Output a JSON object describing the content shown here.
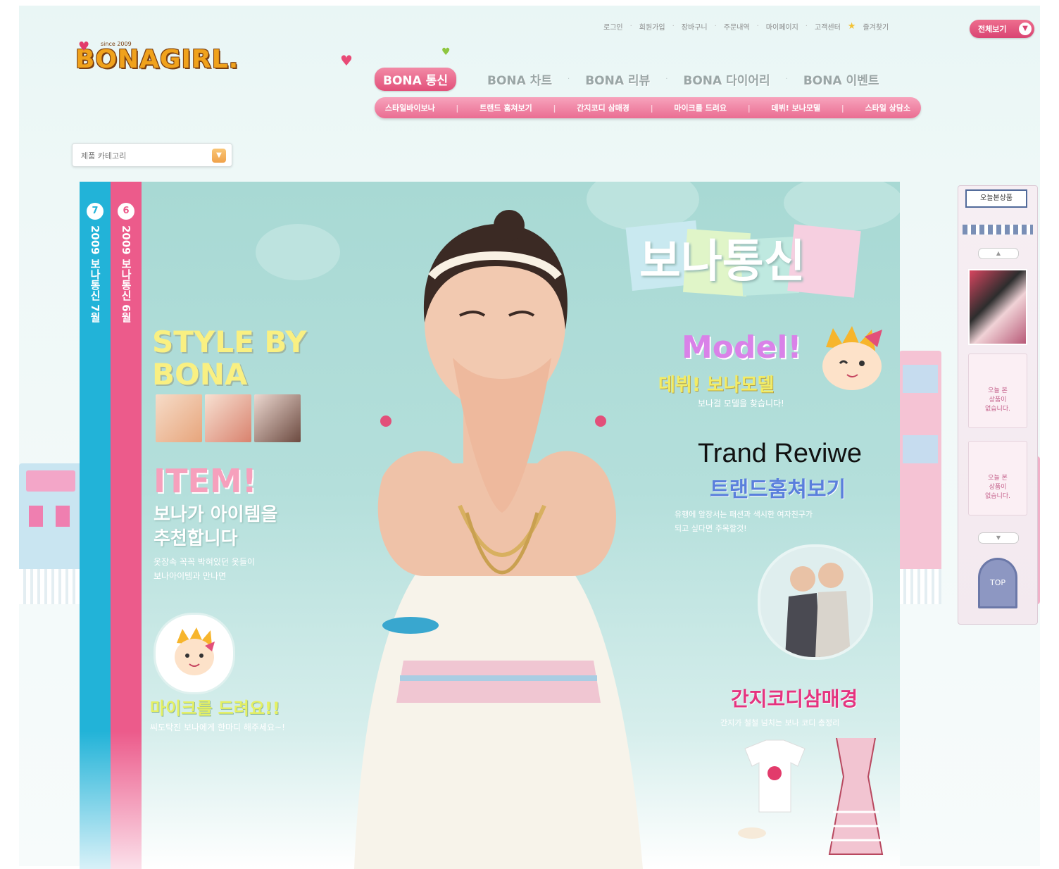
{
  "utility_links": [
    "로그인",
    "회원가입",
    "장바구니",
    "주문내역",
    "마이페이지",
    "고객센터",
    "즐겨찾기"
  ],
  "all_view_button": "전체보기",
  "logo": {
    "brand": "BONAGIRL.",
    "since": "since 2009"
  },
  "main_nav": {
    "items": [
      "BONA 통신",
      "BONA 차트",
      "BONA 리뷰",
      "BONA 다이어리",
      "BONA 이벤트"
    ],
    "active_index": 0
  },
  "sub_nav": [
    "스타일바이보나",
    "트랜드 훔쳐보기",
    "간지코디 삼매경",
    "마이크를 드려요",
    "데뷔! 보나모델",
    "스타일 상담소"
  ],
  "category_select": {
    "value": "제품 카테고리"
  },
  "side_tabs": [
    {
      "num": "7",
      "label": "2009 보나통신 7월",
      "color": "#22b3d8"
    },
    {
      "num": "6",
      "label": "2009 보나통신 6월",
      "color": "#ec5b8b"
    }
  ],
  "hero": {
    "bona_title": "보나통신",
    "style_by": [
      "STYLE BY",
      "BONA"
    ],
    "item": {
      "title": "ITEM!",
      "sub": [
        "보나가 아이템을",
        "추천합니다"
      ],
      "desc": [
        "옷장속 꼭꼭 박혀있던 옷들이",
        "보나아이템과 만나면"
      ]
    },
    "mic": {
      "title": "마이크를 드려요!!",
      "desc": "씨도탁진 보나에게 한마디 해주세요~!"
    },
    "model": {
      "title": "Model!",
      "sub": "데뷔! 보나모델",
      "desc": "보나걸 모델을 찾습니다!"
    },
    "trend": {
      "title": "Trand Reviwe",
      "sub": "트랜드훔쳐보기",
      "desc": [
        "유행에 앞장서는 패션과 색시한 여자친구가",
        "되고 싶다면 주목할것!"
      ]
    },
    "ganji": {
      "title": "간지코디삼매경",
      "desc": "간지가 철철 넘치는 보나 코디 총정리"
    }
  },
  "quick_bar": {
    "label": "오늘본상품",
    "up": "▲",
    "down": "▼",
    "empty_text": [
      "오늘 본",
      "상품이",
      "없습니다."
    ],
    "top": "TOP"
  }
}
